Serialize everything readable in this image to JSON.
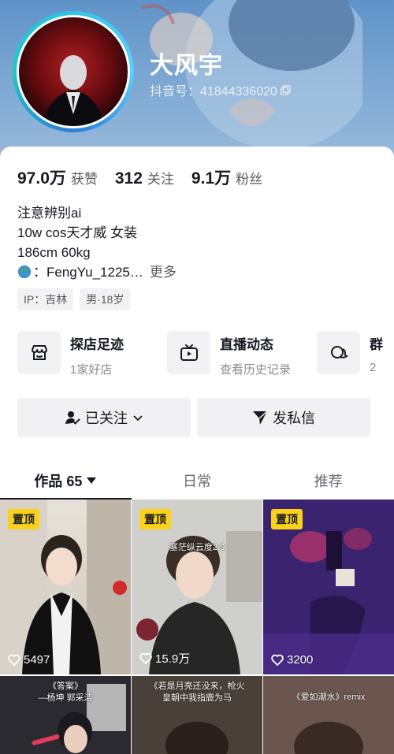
{
  "profile": {
    "nickname": "大风宇",
    "douyin_id": "抖音号：41844336020"
  },
  "stats": [
    {
      "value": "97.0万",
      "label": "获赞"
    },
    {
      "value": "312",
      "label": "关注"
    },
    {
      "value": "9.1万",
      "label": "粉丝"
    }
  ],
  "bio": {
    "line1": "注意辨别ai",
    "line2": "10w cos天才威 女装",
    "line3": "186cm 60kg",
    "line4": "：FengYu_1225…",
    "more": "更多"
  },
  "tags": [
    "IP：吉林",
    "男·18岁"
  ],
  "services": [
    {
      "title": "探店足迹",
      "sub": "1家好店",
      "icon": "shop-icon"
    },
    {
      "title": "直播动态",
      "sub": "查看历史记录",
      "icon": "tv-icon"
    },
    {
      "title": "群",
      "sub": "2",
      "icon": "chat-icon"
    }
  ],
  "actions": {
    "follow": "已关注",
    "message": "发私信"
  },
  "tabs": {
    "works": "作品 65",
    "daily": "日常",
    "recommend": "推荐"
  },
  "videos": [
    {
      "pinned": "置顶",
      "likes": "5497"
    },
    {
      "pinned": "置顶",
      "likes": "15.9万",
      "caption_top": "塞茫纵云度2.0"
    },
    {
      "pinned": "置顶",
      "likes": "3200"
    },
    {
      "caption": "《答案》",
      "caption2": "—杨坤 郭采洁"
    },
    {
      "caption": "《若是月亮还没来，枪火",
      "caption2": "皇朝中我指鹿为马"
    },
    {
      "caption": "《爱如潮水》remix"
    }
  ],
  "colors": {
    "banner": "#6f9ccd",
    "pin_yellow": "#fbd21a",
    "avatar_ring": "#2ec5e8"
  }
}
